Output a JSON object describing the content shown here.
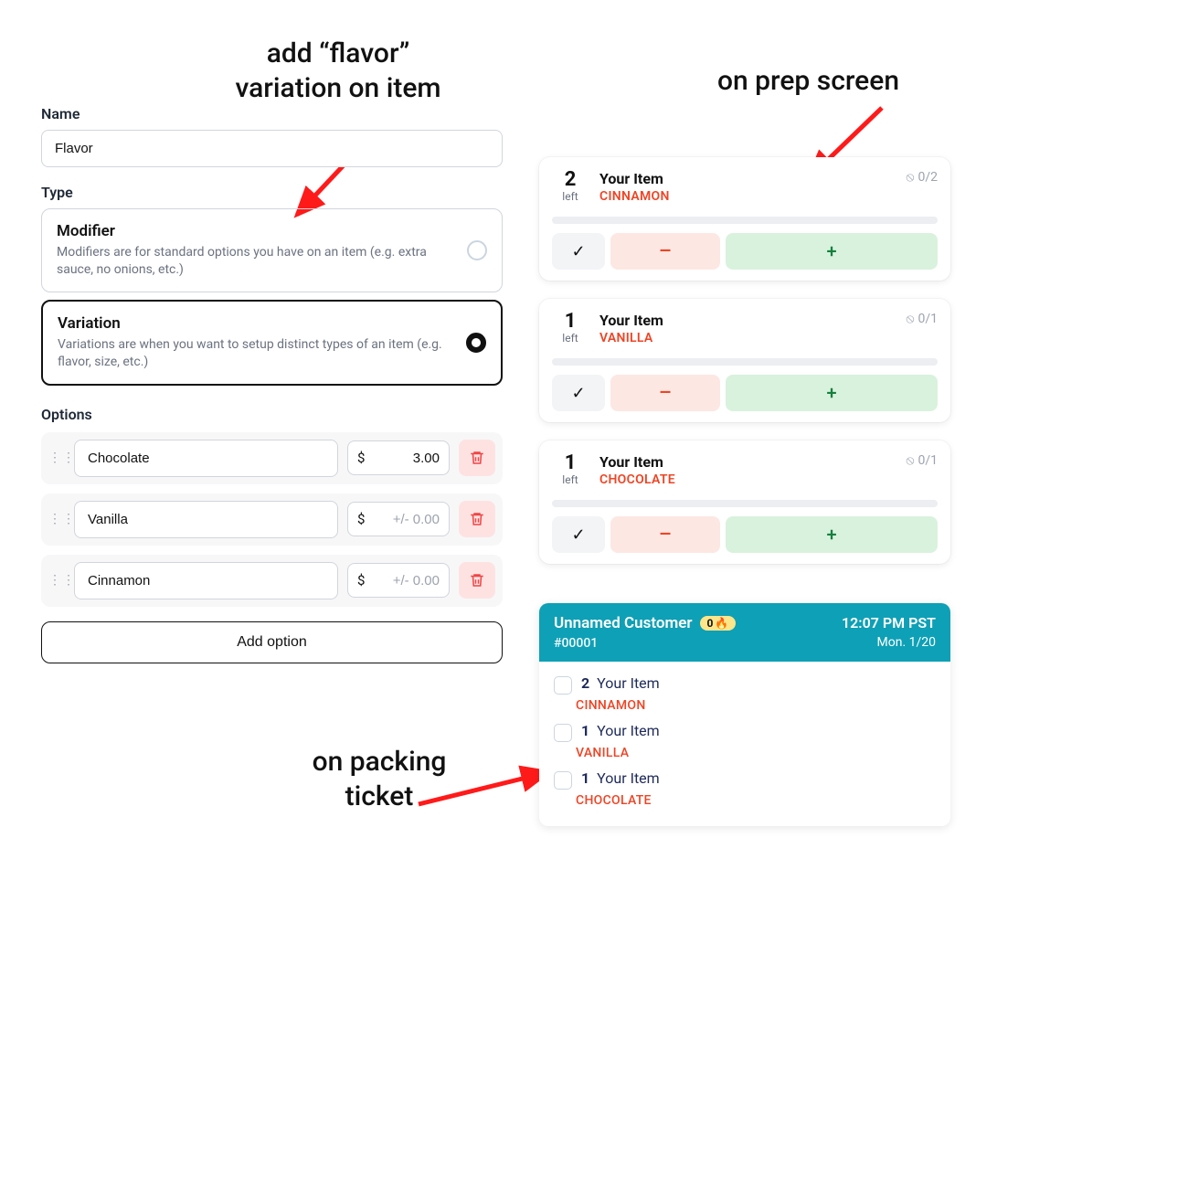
{
  "annotations": {
    "add_flavor": "add “flavor”\nvariation on item",
    "prep_screen": "on prep screen",
    "packing": "on packing\nticket"
  },
  "form": {
    "name_label": "Name",
    "name_value": "Flavor",
    "type_label": "Type",
    "modifier": {
      "title": "Modifier",
      "desc": "Modifiers are for standard options you have on an item (e.g. extra sauce, no onions, etc.)"
    },
    "variation": {
      "title": "Variation",
      "desc": "Variations are when you want to setup distinct types of an item (e.g. flavor, size, etc.)"
    },
    "options_label": "Options",
    "currency": "$",
    "price_placeholder": "+/- 0.00",
    "options": [
      {
        "name": "Chocolate",
        "price": "3.00"
      },
      {
        "name": "Vanilla",
        "price": ""
      },
      {
        "name": "Cinnamon",
        "price": ""
      }
    ],
    "add_option_label": "Add option"
  },
  "prep": {
    "left_label": "left",
    "item_name": "Your Item",
    "check": "✓",
    "minus": "–",
    "plus": "+",
    "status_icon": "⦸",
    "cards": [
      {
        "qty": "2",
        "variation": "CINNAMON",
        "status": "0/2"
      },
      {
        "qty": "1",
        "variation": "VANILLA",
        "status": "0/1"
      },
      {
        "qty": "1",
        "variation": "CHOCOLATE",
        "status": "0/1"
      }
    ]
  },
  "ticket": {
    "customer": "Unnamed Customer",
    "badge_count": "0",
    "badge_icon": "🔥",
    "order_no": "#00001",
    "time": "12:07 PM PST",
    "date": "Mon. 1/20",
    "lines": [
      {
        "qty": "2",
        "name": "Your Item",
        "variation": "CINNAMON"
      },
      {
        "qty": "1",
        "name": "Your Item",
        "variation": "VANILLA"
      },
      {
        "qty": "1",
        "name": "Your Item",
        "variation": "CHOCOLATE"
      }
    ]
  }
}
